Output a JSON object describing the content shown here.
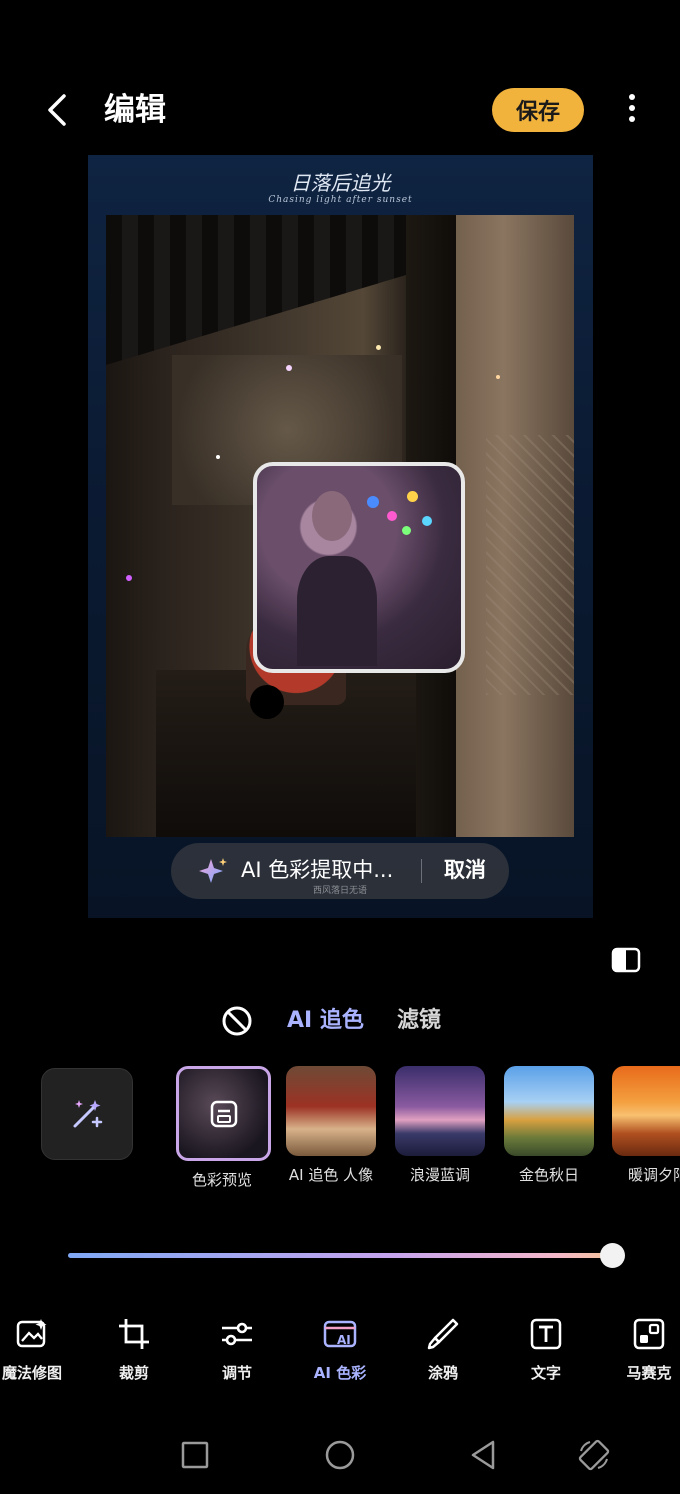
{
  "header": {
    "title": "编辑",
    "save_label": "保存"
  },
  "frame": {
    "title": "日落后追光",
    "subtitle": "Chasing light after sunset"
  },
  "ai_status": {
    "text": "AI 色彩提取中...",
    "cancel_label": "取消",
    "watermark": "西风落日无语"
  },
  "mode_tabs": {
    "ai_color": "AI 追色",
    "filter": "滤镜"
  },
  "presets": [
    {
      "label": "色彩预览"
    },
    {
      "label": "AI 追色 人像"
    },
    {
      "label": "浪漫蓝调"
    },
    {
      "label": "金色秋日"
    },
    {
      "label": "暖调夕阳"
    }
  ],
  "slider": {
    "value_fraction": 1.0
  },
  "toolbar": [
    {
      "label": "魔法修图",
      "icon": "magic-edit-icon"
    },
    {
      "label": "裁剪",
      "icon": "crop-icon"
    },
    {
      "label": "调节",
      "icon": "adjust-icon"
    },
    {
      "label": "AI 色彩",
      "icon": "ai-color-icon"
    },
    {
      "label": "涂鸦",
      "icon": "brush-icon"
    },
    {
      "label": "文字",
      "icon": "text-icon"
    },
    {
      "label": "马赛克",
      "icon": "mosaic-icon"
    }
  ],
  "colors": {
    "accent": "#f2b33d",
    "active": "#a9b3ff",
    "background": "#000000"
  }
}
